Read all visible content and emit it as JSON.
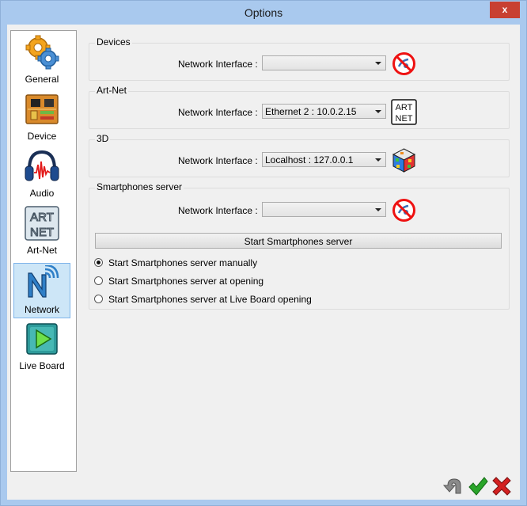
{
  "window": {
    "title": "Options",
    "close_label": "x"
  },
  "sidebar": {
    "items": [
      {
        "label": "General",
        "icon": "gears-icon",
        "selected": false
      },
      {
        "label": "Device",
        "icon": "circuit-board-icon",
        "selected": false
      },
      {
        "label": "Audio",
        "icon": "headphones-icon",
        "selected": false
      },
      {
        "label": "Art-Net",
        "icon": "artnet-logo-icon",
        "selected": false
      },
      {
        "label": "Network",
        "icon": "network-icon",
        "selected": true
      },
      {
        "label": "Live Board",
        "icon": "play-icon",
        "selected": false
      }
    ]
  },
  "devices": {
    "title": "Devices",
    "label": "Network Interface :",
    "value": "",
    "status_icon": "no-connection-icon"
  },
  "artnet": {
    "title": "Art-Net",
    "label": "Network Interface :",
    "value": "Ethernet 2 : 10.0.2.15",
    "status_icon": "artnet-logo-icon",
    "logo_line1": "ART",
    "logo_line2": "NET"
  },
  "threed": {
    "title": "3D",
    "label": "Network Interface :",
    "value": "Localhost : 127.0.0.1",
    "status_icon": "cube-icon"
  },
  "smartphones": {
    "title": "Smartphones server",
    "label": "Network Interface :",
    "value": "",
    "status_icon": "no-connection-icon",
    "start_button": "Start Smartphones server",
    "options": [
      {
        "label": "Start Smartphones server manually",
        "checked": true
      },
      {
        "label": "Start Smartphones server at opening",
        "checked": false
      },
      {
        "label": "Start Smartphones server at Live Board opening",
        "checked": false
      }
    ]
  },
  "footer": {
    "icons": [
      "undo-arrow-icon",
      "check-icon",
      "cancel-x-icon"
    ]
  },
  "colors": {
    "title_bar": "#a9c9ee",
    "close_button": "#c84031",
    "selection": "#cde6f7",
    "check_green": "#2aa52a",
    "cancel_red": "#d42020"
  }
}
